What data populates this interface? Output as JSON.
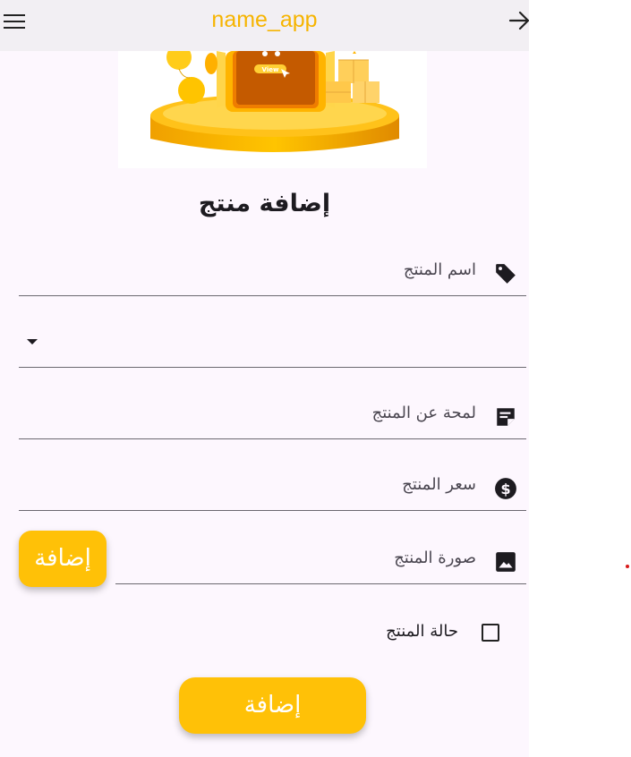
{
  "app_bar": {
    "title": "name_app",
    "menu_icon": "hamburger-menu-icon",
    "back_icon": "arrow-forward-icon"
  },
  "hero": {
    "banner_text": "View"
  },
  "form": {
    "heading": "إضافة منتج",
    "fields": {
      "name": {
        "label": "اسم المنتج",
        "icon": "tag-icon"
      },
      "category": {
        "value": "",
        "icon": "dropdown-arrow-icon"
      },
      "description": {
        "label": "لمحة عن المنتج",
        "icon": "note-icon"
      },
      "price": {
        "label": "سعر المنتج",
        "icon": "dollar-icon"
      },
      "image": {
        "label": "صورة المنتج",
        "icon": "image-icon"
      }
    },
    "status": {
      "label": "حالة المنتج",
      "checked": false
    },
    "add_image_button": "إضافة",
    "submit_button": "إضافة"
  },
  "colors": {
    "accent": "#ffc107",
    "title": "#f6b400",
    "app_bar_bg": "#f2eff3",
    "page_bg": "#fdf7fe"
  }
}
